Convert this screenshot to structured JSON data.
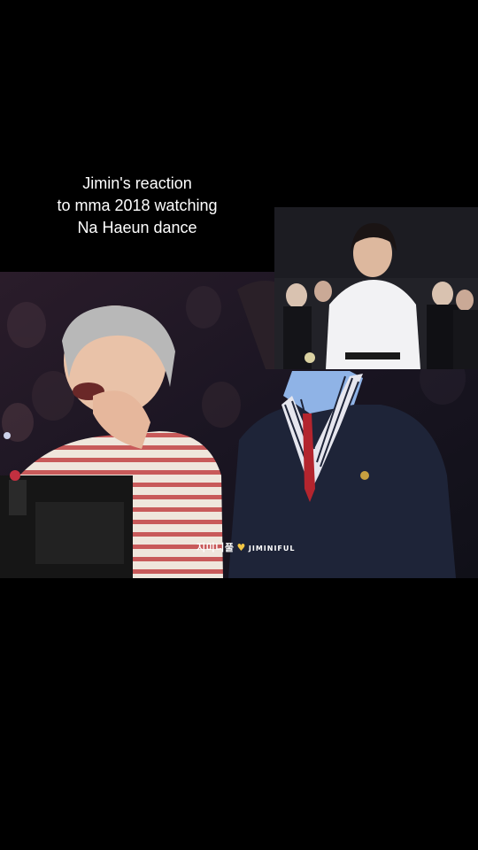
{
  "caption": {
    "line1": "Jimin's reaction",
    "line2": "to mma 2018 watching",
    "line3": "Na Haeun dance"
  },
  "watermark": {
    "korean": "지미니풀",
    "heart": "♥",
    "handle": "JIMINIFUL"
  },
  "colors": {
    "background": "#000000",
    "heart": "#f3c644"
  }
}
